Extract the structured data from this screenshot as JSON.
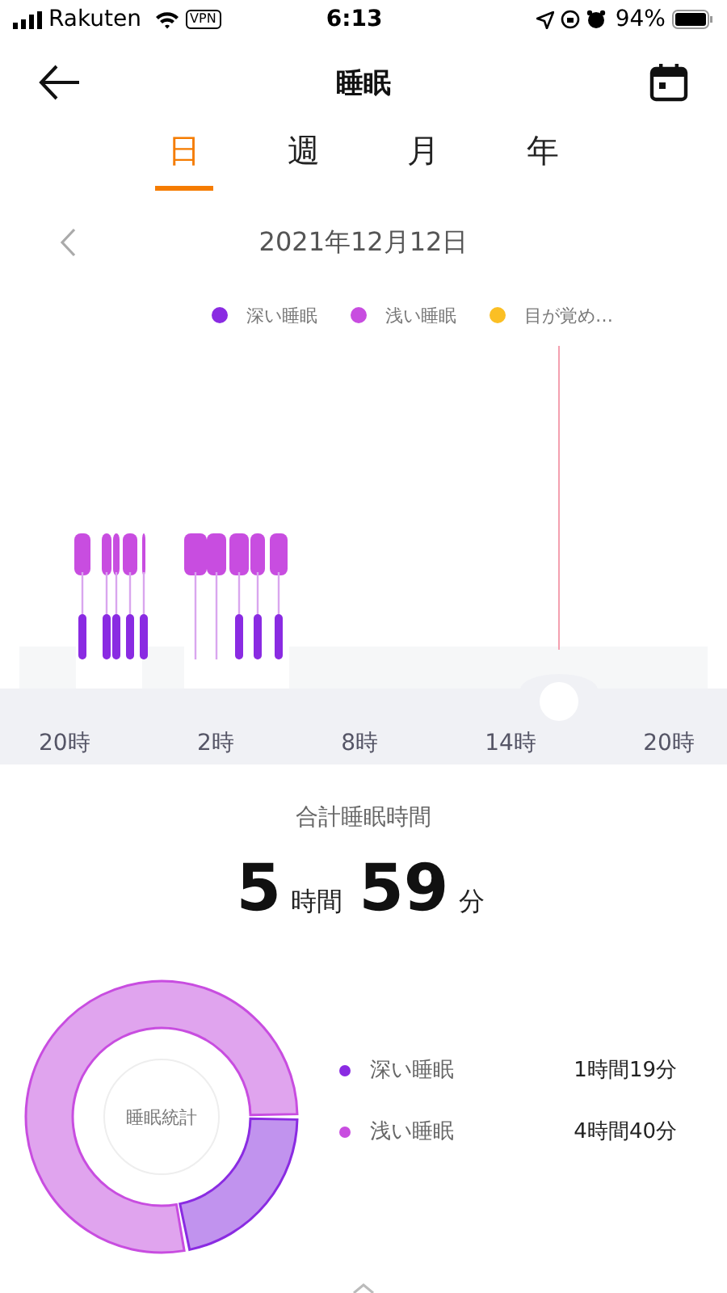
{
  "status_bar": {
    "carrier": "Rakuten",
    "vpn": "VPN",
    "time": "6:13",
    "battery": "94%"
  },
  "header": {
    "title": "睡眠"
  },
  "tabs": [
    {
      "label": "日",
      "selected": true
    },
    {
      "label": "週",
      "selected": false
    },
    {
      "label": "月",
      "selected": false
    },
    {
      "label": "年",
      "selected": false
    }
  ],
  "date": "2021年12月12日",
  "legend": [
    {
      "label": "深い睡眠",
      "color": "#8a2be2"
    },
    {
      "label": "浅い睡眠",
      "color": "#c84de0"
    },
    {
      "label": "目が覚め…",
      "color": "#fbbf24"
    }
  ],
  "axis_labels": [
    "20時",
    "2時",
    "8時",
    "14時",
    "20時"
  ],
  "total": {
    "title": "合計睡眠時間",
    "hours": "5",
    "hours_unit": "時間",
    "minutes": "59",
    "minutes_unit": "分"
  },
  "stats": {
    "center_label": "睡眠統計",
    "items": [
      {
        "label": "深い睡眠",
        "value": "1時間19分",
        "color": "#8a2be2"
      },
      {
        "label": "浅い睡眠",
        "value": "4時間40分",
        "color": "#c84de0"
      }
    ]
  }
}
